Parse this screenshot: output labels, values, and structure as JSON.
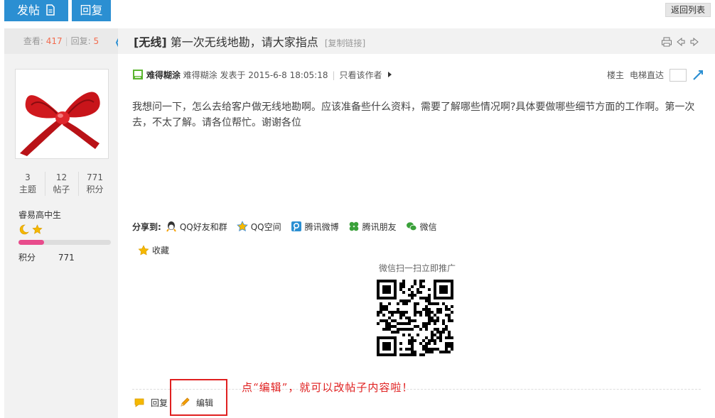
{
  "topbar": {
    "post_label": "发帖",
    "reply_label": "回复",
    "back_label": "返回列表"
  },
  "stats": {
    "views_label": "查看:",
    "views": "417",
    "replies_label": "回复:",
    "replies": "5"
  },
  "thread": {
    "category": "[无线]",
    "title": "第一次无线地勘，请大家指点",
    "copy_link": "[复制链接]"
  },
  "author": {
    "name": "难得糊涂",
    "counts": [
      {
        "value": "3",
        "label": "主题"
      },
      {
        "value": "12",
        "label": "帖子"
      },
      {
        "value": "771",
        "label": "积分"
      }
    ],
    "group": "睿易高中生",
    "credit_label": "积分",
    "credit_value": "771",
    "progress_fraction": 0.28
  },
  "post": {
    "author": "难得糊涂",
    "meta": "难得糊涂 发表于 2015-6-8 18:05:18",
    "only_author": "只看该作者",
    "floor": "楼主",
    "elevator": "电梯直达",
    "body": "我想问一下，怎么去给客户做无线地勘啊。应该准备些什么资料，需要了解哪些情况啊?具体要做哪些细节方面的工作啊。第一次去，不太了解。请各位帮忙。谢谢各位"
  },
  "share": {
    "label": "分享到:",
    "items": [
      {
        "label": "QQ好友和群",
        "icon": "qq-icon"
      },
      {
        "label": "QQ空间",
        "icon": "qzone-icon"
      },
      {
        "label": "腾讯微博",
        "icon": "tencent-weibo-icon"
      },
      {
        "label": "腾讯朋友",
        "icon": "tencent-friends-icon"
      },
      {
        "label": "微信",
        "icon": "wechat-icon"
      }
    ]
  },
  "favorite_label": "收藏",
  "qr_title": "微信扫一扫立即推广",
  "footer": {
    "reply_label": "回复",
    "edit_label": "编辑"
  },
  "annotation": "点“编辑”，就可以改帖子内容啦！",
  "colors": {
    "accent": "#2b8fd2",
    "count": "#f26c4f",
    "annotation": "#e02020",
    "progress": "#e84c8c"
  }
}
